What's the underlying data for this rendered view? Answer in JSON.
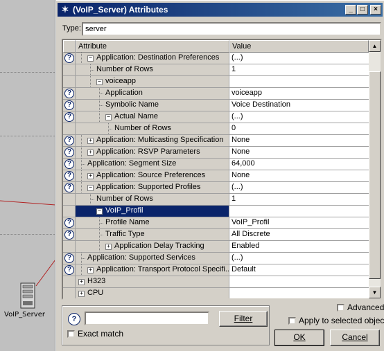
{
  "background": {
    "device_label": "VoIP_Server"
  },
  "window": {
    "title": "(VoIP_Server) Attributes",
    "controls": {
      "minimize": "_",
      "maximize": "□",
      "close": "×"
    }
  },
  "type_field": {
    "label": "Type:",
    "value": "server"
  },
  "grid": {
    "headers": {
      "attribute": "Attribute",
      "value": "Value"
    },
    "rows": [
      {
        "help": true,
        "expander": "minus",
        "indent": 1,
        "label": "Application: Destination Preferences",
        "value": "(...)"
      },
      {
        "help": false,
        "expander": "",
        "indent": 2,
        "label": "Number of Rows",
        "value": "1"
      },
      {
        "help": false,
        "expander": "minus",
        "indent": 2,
        "label": "voiceapp",
        "value": ""
      },
      {
        "help": true,
        "expander": "",
        "indent": 3,
        "label": "Application",
        "value": "voiceapp"
      },
      {
        "help": true,
        "expander": "",
        "indent": 3,
        "label": "Symbolic Name",
        "value": "Voice Destination"
      },
      {
        "help": true,
        "expander": "minus",
        "indent": 3,
        "label": "Actual Name",
        "value": "(...)"
      },
      {
        "help": false,
        "expander": "",
        "indent": 4,
        "label": "Number of Rows",
        "value": "0"
      },
      {
        "help": true,
        "expander": "plus",
        "indent": 1,
        "label": "Application: Multicasting Specification",
        "value": "None"
      },
      {
        "help": true,
        "expander": "plus",
        "indent": 1,
        "label": "Application: RSVP Parameters",
        "value": "None"
      },
      {
        "help": true,
        "expander": "",
        "indent": 1,
        "label": "Application: Segment Size",
        "value": "64,000"
      },
      {
        "help": true,
        "expander": "plus",
        "indent": 1,
        "label": "Application: Source Preferences",
        "value": "None"
      },
      {
        "help": true,
        "expander": "minus",
        "indent": 1,
        "label": "Application: Supported Profiles",
        "value": "(...)"
      },
      {
        "help": false,
        "expander": "",
        "indent": 2,
        "label": "Number of Rows",
        "value": "1"
      },
      {
        "help": false,
        "expander": "minus",
        "indent": 2,
        "label": "VoIP_Profil",
        "value": "",
        "selected": true
      },
      {
        "help": true,
        "expander": "",
        "indent": 3,
        "label": "Profile Name",
        "value": "VoIP_Profil"
      },
      {
        "help": true,
        "expander": "",
        "indent": 3,
        "label": "Traffic Type",
        "value": "All Discrete"
      },
      {
        "help": false,
        "expander": "plus",
        "indent": 3,
        "label": "Application Delay Tracking",
        "value": "Enabled"
      },
      {
        "help": true,
        "expander": "",
        "indent": 1,
        "label": "Application: Supported Services",
        "value": "(...)"
      },
      {
        "help": true,
        "expander": "plus",
        "indent": 1,
        "label": "Application: Transport Protocol Specifi...",
        "value": "Default"
      },
      {
        "help": false,
        "expander": "plus",
        "indent": 0,
        "label": "H323",
        "value": ""
      },
      {
        "help": false,
        "expander": "plus",
        "indent": 0,
        "label": "CPU",
        "value": ""
      }
    ]
  },
  "filter": {
    "value": "",
    "button_label": "Filter",
    "exact_match_label": "Exact match"
  },
  "options": {
    "advanced_label": "Advanced",
    "apply_selected_label": "Apply to selected objects"
  },
  "buttons": {
    "ok_label": "OK",
    "cancel_label": "Cancel"
  },
  "colors": {
    "selection": "#0a246a",
    "titlebar": "#0a246a",
    "face": "#d4d0c8"
  }
}
